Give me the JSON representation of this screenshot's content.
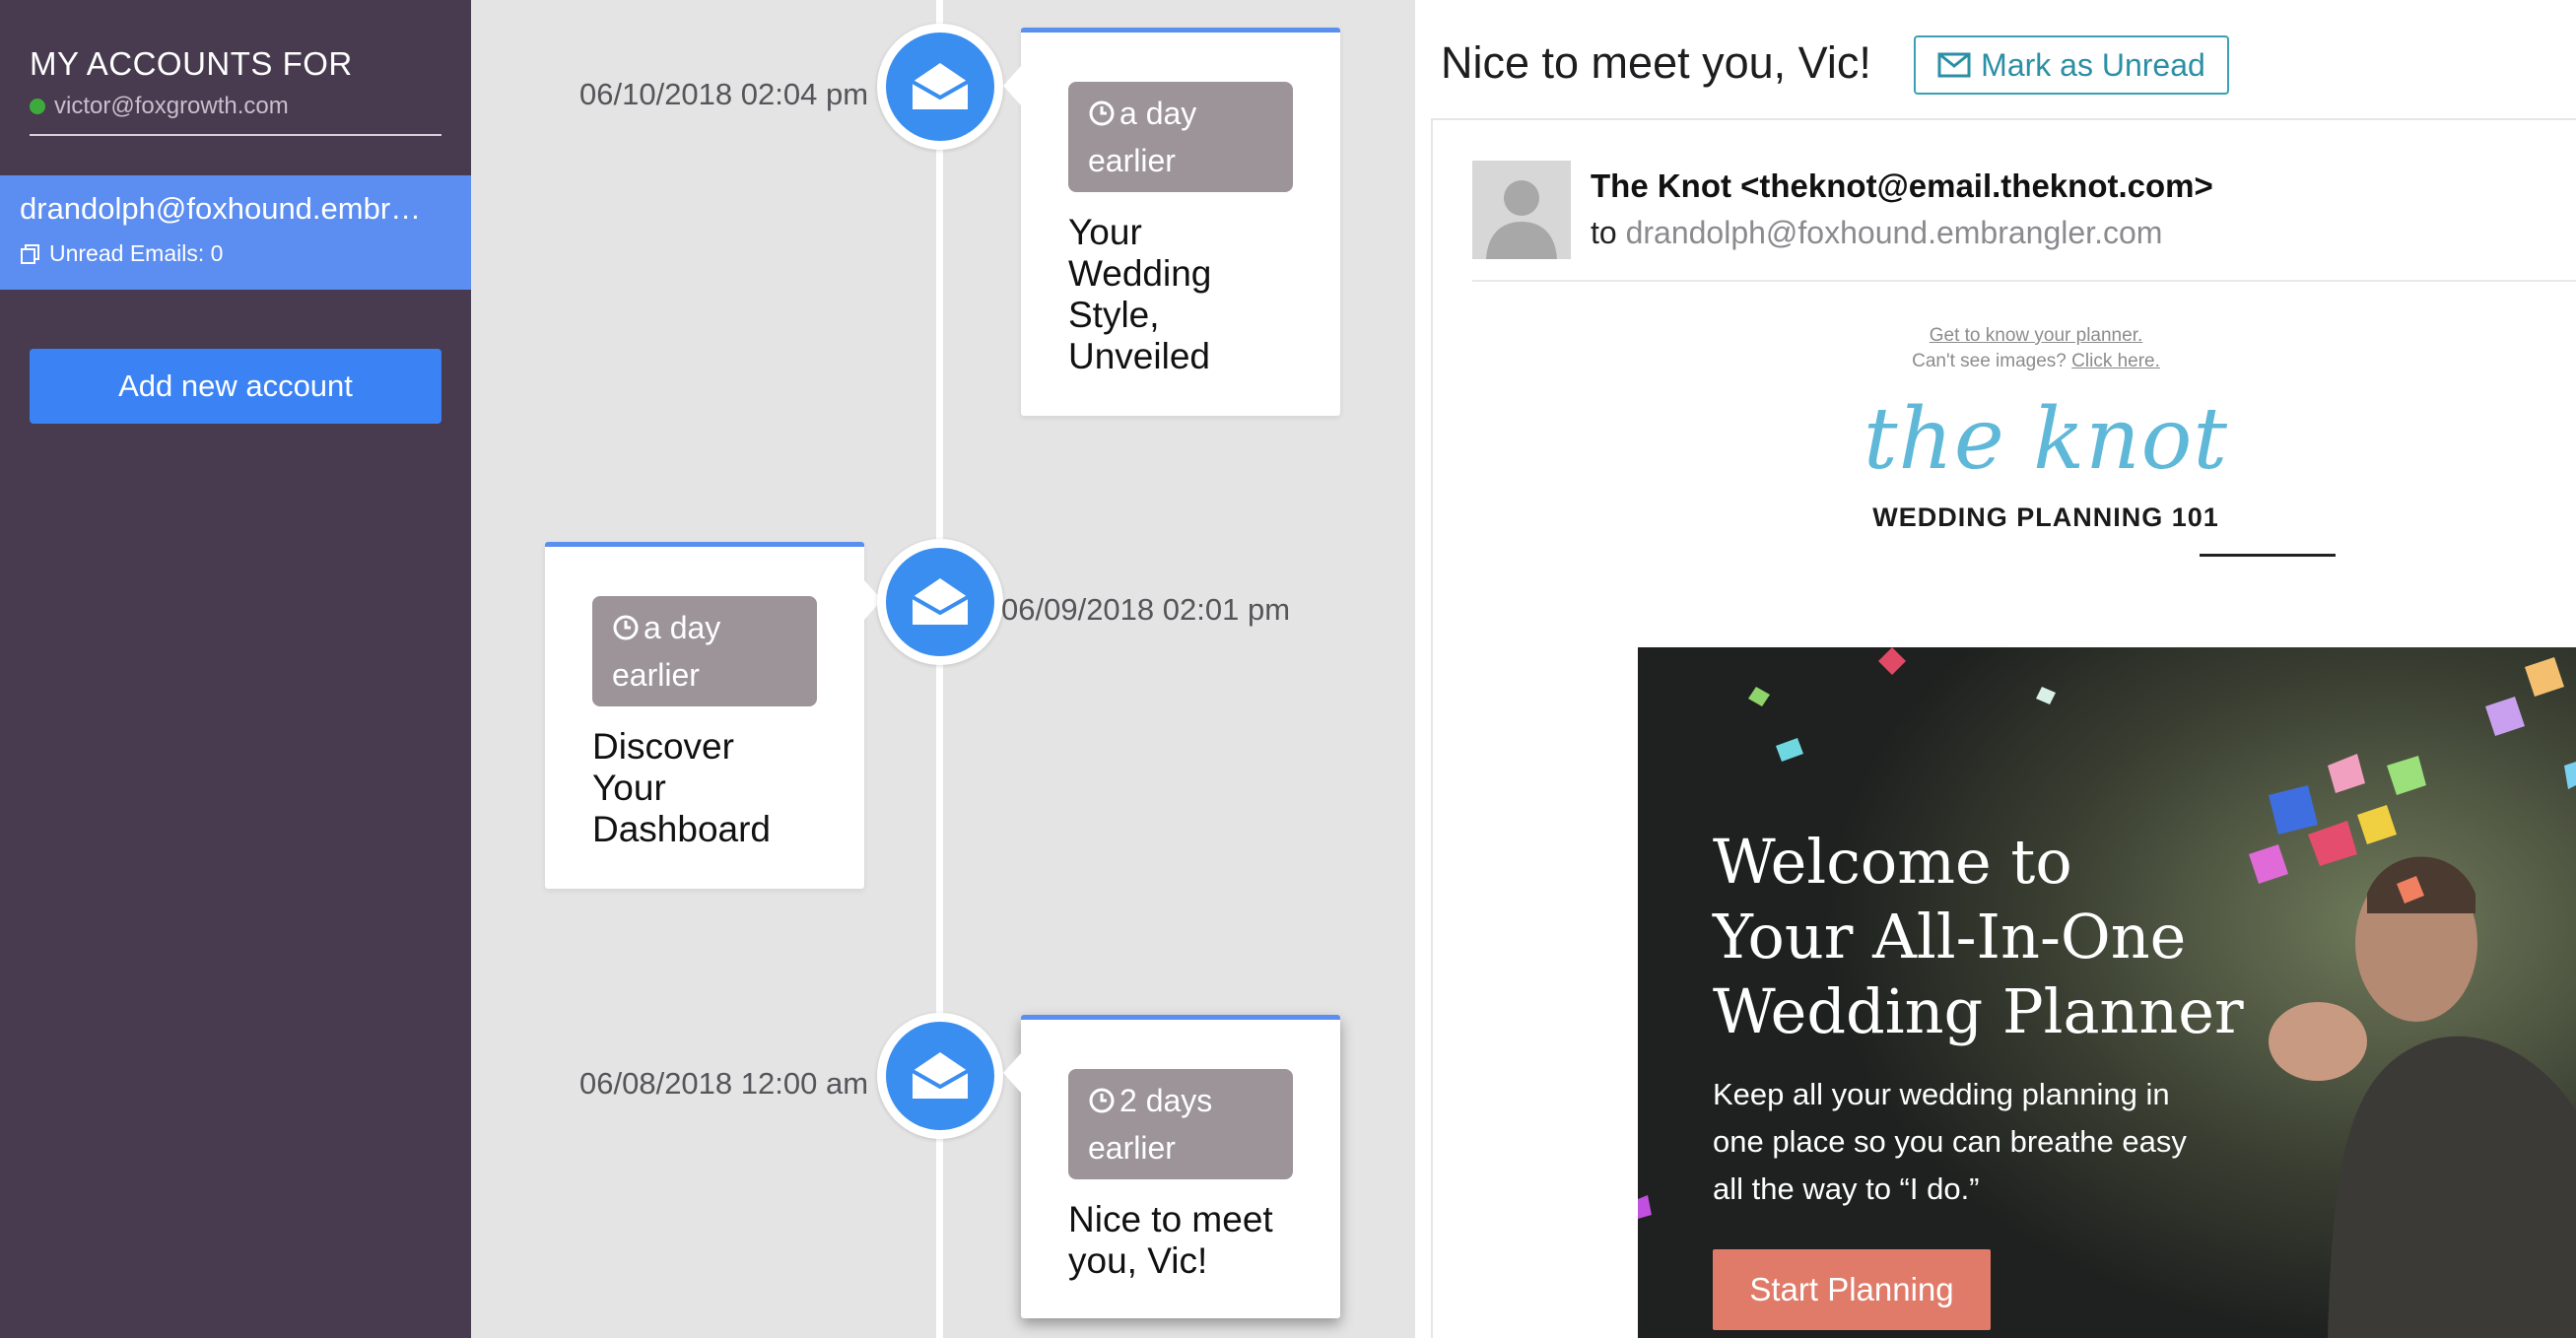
{
  "sidebar": {
    "title": "MY ACCOUNTS FOR",
    "user_email": "victor@foxgrowth.com",
    "account": {
      "email": "drandolph@foxhound.embr…",
      "unread": "Unread Emails: 0"
    },
    "add_button": "Add new account"
  },
  "timeline": {
    "items": [
      {
        "date": "06/10/2018 02:04 pm",
        "badge": "a day earlier",
        "subject": "Your Wedding Style, Unveiled"
      },
      {
        "date": "06/09/2018 02:01 pm",
        "badge": "a day earlier",
        "subject": "Discover Your Dashboard"
      },
      {
        "date": "06/08/2018 12:00 am",
        "badge": "2 days earlier",
        "subject": "Nice to meet you, Vic!"
      }
    ]
  },
  "email": {
    "subject": "Nice to meet you, Vic!",
    "mark_unread": "Mark as Unread",
    "from": "The Knot <theknot@email.theknot.com>",
    "to_prefix": "to",
    "to_address": "drandolph@foxhound.embrangler.com",
    "preheader_link": "Get to know your planner.",
    "preheader_text": "Can't see images?",
    "preheader_click": "Click here.",
    "logo": "the knot",
    "logo_sub": "WEDDING PLANNING 101",
    "hero": {
      "title_line1": "Welcome to",
      "title_line2": "Your All-In-One",
      "title_line3": "Wedding Planner",
      "text": "Keep all your wedding planning in one place so you can breathe easy all the way to “I do.”",
      "button": "Start Planning"
    }
  },
  "colors": {
    "sidebar_bg": "#483b4f",
    "active_account": "#5c8df0",
    "primary_button": "#3b83f5",
    "timeline_bg": "#e4e4e4",
    "node_blue": "#3a8ef0",
    "badge_bg": "#9c9498",
    "teal_accent": "#2b8fa5",
    "cta": "#e07b6a"
  }
}
